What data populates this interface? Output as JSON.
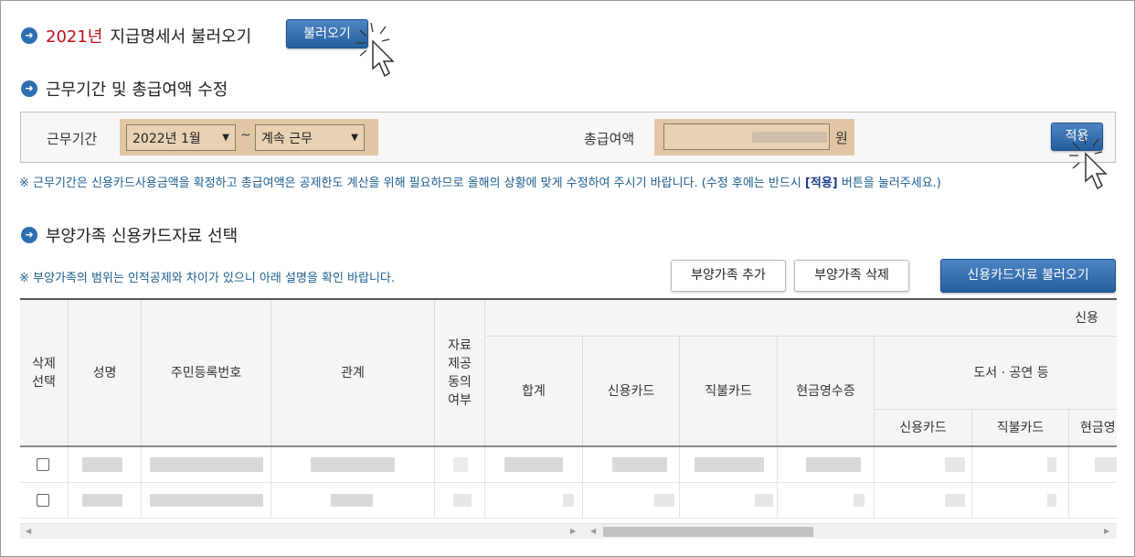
{
  "section1": {
    "year": "2021년",
    "title": "지급명세서 불러오기",
    "button": "불러오기"
  },
  "section2": {
    "title": "근무기간 및 총급여액 수정"
  },
  "filter": {
    "period_label": "근무기간",
    "start_value": "2022년 1월",
    "separator": "~",
    "end_value": "계속 근무",
    "salary_label": "총급여액",
    "salary_unit": "원",
    "apply_button": "적용"
  },
  "note1": {
    "text": "※ 근무기간은 신용카드사용금액을 확정하고 총급여액은 공제한도 계산을 위해 필요하므로 올해의 상황에 맞게 수정하여 주시기 바랍니다. (수정 후에는 반드시 ",
    "bold": "[적용]",
    "tail": " 버튼을 눌러주세요.)"
  },
  "section3": {
    "title": "부양가족 신용카드자료 선택"
  },
  "note2": {
    "text": "※ 부양가족의 범위는 인적공제와 차이가 있으니 아래 설명을 확인 바랍니다."
  },
  "buttons": {
    "add": "부양가족 추가",
    "delete": "부양가족 삭제",
    "load_card": "신용카드자료 불러오기"
  },
  "table": {
    "headers": {
      "delete_select": "삭제\n선택",
      "name": "성명",
      "rrn": "주민등록번호",
      "relation": "관계",
      "consent": "자료\n제공\n동의\n여부",
      "group_top": "신용",
      "total": "합계",
      "credit": "신용카드",
      "debit": "직불카드",
      "cash": "현금영수증",
      "books": "도서 · 공연 등",
      "sub_credit": "신용카드",
      "sub_debit": "직불카드",
      "sub_cash": "현금영"
    }
  },
  "colors": {
    "accent": "#255f9e",
    "bullet": "#2d6fb0",
    "year": "#c0101a",
    "tan": "#e0c6a3",
    "note": "#1d5c8c"
  }
}
